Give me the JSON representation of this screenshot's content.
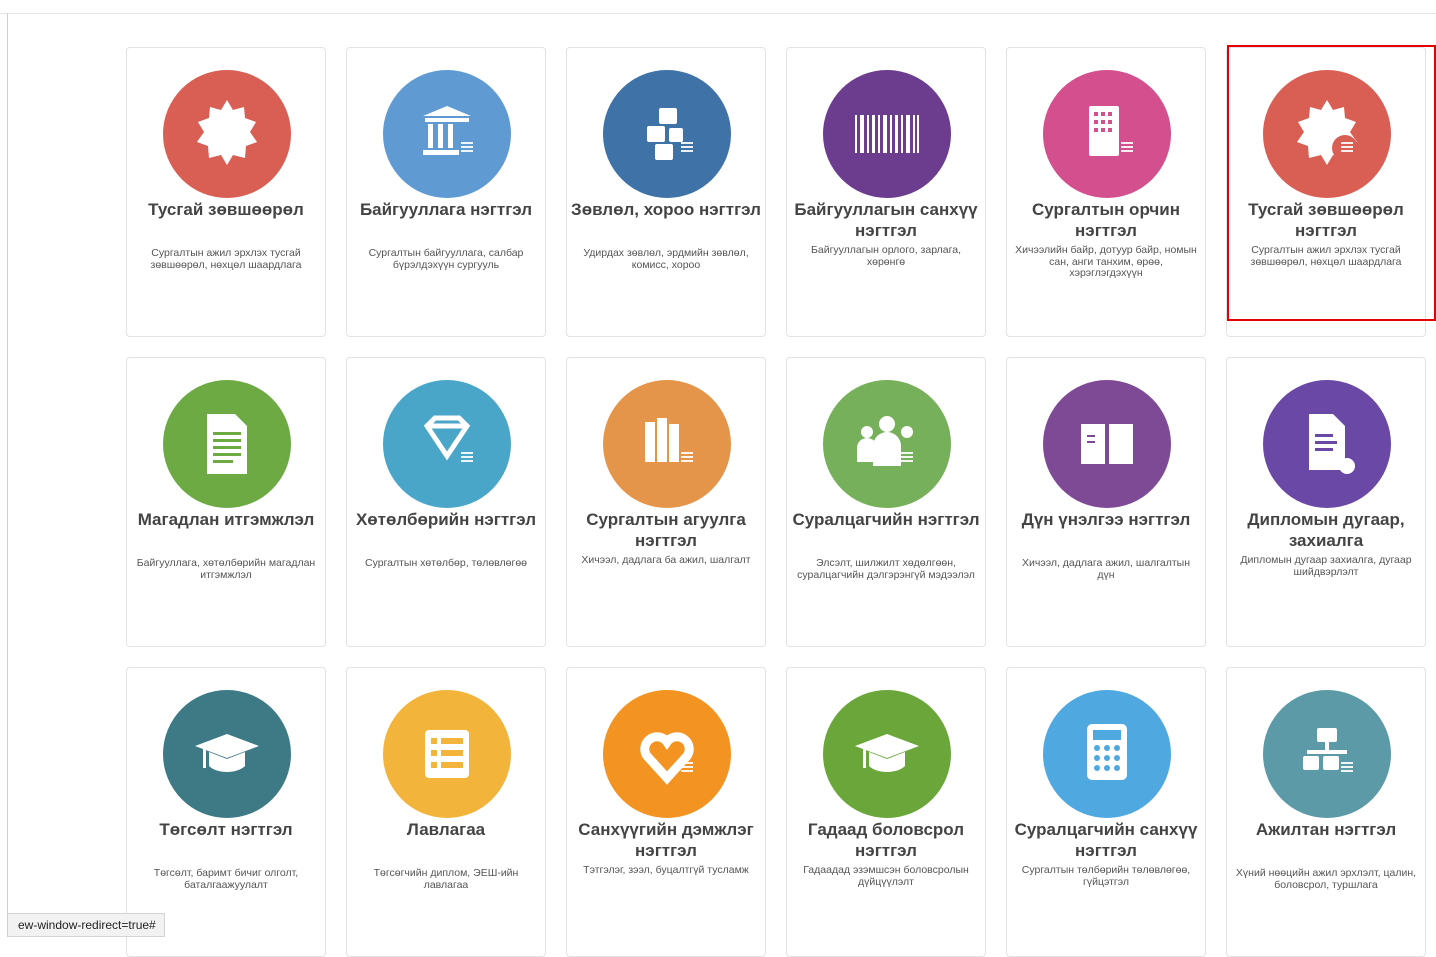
{
  "tiles": [
    {
      "title": "Тусгай зөвшөөрөл",
      "desc": "Сургалтын ажил эрхлэх тусгай зөвшөөрөл, нөхцөл шаардлага",
      "icon": "badge-icon",
      "color": "#d95f55"
    },
    {
      "title": "Байгууллага нэгтгэл",
      "desc": "Сургалтын байгууллага, салбар бүрэлдэхүүн сургууль",
      "icon": "institution-building-icon",
      "color": "#5f9ad2"
    },
    {
      "title": "Зөвлөл, хороо нэгтгэл",
      "desc": "Удирдах зөвлөл, эрдмийн зөвлөл, комисс, хороо",
      "icon": "cubes-icon",
      "color": "#3f72a6"
    },
    {
      "title": "Байгууллагын санхүү нэгтгэл",
      "desc": "Байгууллагын орлого, зарлага, хөрөнгө",
      "icon": "barcode-icon",
      "color": "#6c3c8e"
    },
    {
      "title": "Сургалтын орчин нэгтгэл",
      "desc": "Хичээлийн байр, дотуур байр, номын сан, анги танхим, өрөө, хэрэглэгдэхүүн",
      "icon": "building-icon",
      "color": "#d34f8e"
    },
    {
      "title": "Тусгай зөвшөөрөл нэгтгэл",
      "desc": "Сургалтын ажил эрхлэх тусгай зөвшөөрөл, нөхцөл шаардлага",
      "icon": "badge-list-icon",
      "color": "#d95f55"
    },
    {
      "title": "Магадлан итгэмжлэл",
      "desc": "Байгууллага, хөтөлбөрийн магадлан итгэмжлэл",
      "icon": "document-icon",
      "color": "#6eaa44"
    },
    {
      "title": "Хөтөлбөрийн нэгтгэл",
      "desc": "Сургалтын хөтөлбөр, төлөвлөгөө",
      "icon": "diamond-icon",
      "color": "#4aa6c8"
    },
    {
      "title": "Сургалтын агуулга нэгтгэл",
      "desc": "Хичээл, дадлага ба ажил, шалгалт",
      "icon": "books-icon",
      "color": "#e5954a"
    },
    {
      "title": "Суралцагчийн нэгтгэл",
      "desc": "Элсэлт, шилжилт хөдөлгөөн, суралцагчийн дэлгэрэнгүй мэдээлэл",
      "icon": "users-icon",
      "color": "#76b05a"
    },
    {
      "title": "Дүн үнэлгээ нэгтгэл",
      "desc": "Хичээл, дадлага ажил, шалгалтын дүн",
      "icon": "open-book-icon",
      "color": "#7e4a96"
    },
    {
      "title": "Дипломын дугаар, захиалга",
      "desc": "Дипломын дугаар захиалга, дугаар шийдвэрлэлт",
      "icon": "file-gear-icon",
      "color": "#6a48a6"
    },
    {
      "title": "Төгсөлт нэгтгэл",
      "desc": "Төгсөлт, баримт бичиг олголт, баталгаажуулалт",
      "icon": "graduation-cap-icon",
      "color": "#3e7a86"
    },
    {
      "title": "Лавлагаа",
      "desc": "Төгсөгчийн диплом, ЭЕШ-ийн лавлагаа",
      "icon": "list-icon",
      "color": "#f2b43a"
    },
    {
      "title": "Санхүүгийн дэмжлэг нэгтгэл",
      "desc": "Тэтгэлэг, зээл, буцалтгүй тусламж",
      "icon": "heart-icon",
      "color": "#f39422"
    },
    {
      "title": "Гадаад боловсрол нэгтгэл",
      "desc": "Гадаадад эзэмшсэн боловсролын дүйцүүлэлт",
      "icon": "graduation-cap-icon",
      "color": "#6aa63a"
    },
    {
      "title": "Суралцагчийн санхүү нэгтгэл",
      "desc": "Сургалтын төлбөрийн төлөвлөгөө, гүйцэтгэл",
      "icon": "calculator-icon",
      "color": "#4fa8e0"
    },
    {
      "title": "Ажилтан нэгтгэл",
      "desc": "Хүний нөөцийн ажил эрхлэлт, цалин, боловсрол, туршлага",
      "icon": "org-chart-icon",
      "color": "#5b9aa6"
    }
  ],
  "status_bar": {
    "url_fragment": "ew-window-redirect=true#"
  }
}
